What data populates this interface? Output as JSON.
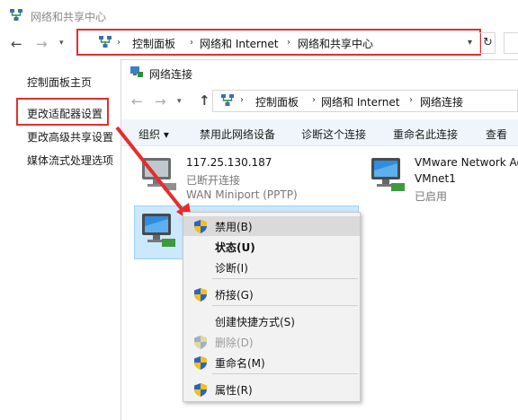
{
  "outer_window": {
    "title": "网络和共享中心",
    "breadcrumb": [
      "控制面板",
      "网络和 Internet",
      "网络和共享中心"
    ]
  },
  "sidebar": {
    "items": [
      {
        "label": "控制面板主页"
      },
      {
        "label": "更改适配器设置"
      },
      {
        "label": "更改高级共享设置"
      },
      {
        "label": "媒体流式处理选项"
      }
    ]
  },
  "inner_window": {
    "title": "网络连接",
    "breadcrumb": [
      "控制面板",
      "网络和 Internet",
      "网络连接"
    ],
    "toolbar": {
      "organize": "组织 ▾",
      "disable": "禁用此网络设备",
      "diagnose": "诊断这个连接",
      "rename": "重命名此连接",
      "view": "查看"
    },
    "connections": [
      {
        "name": "117.25.130.187",
        "status": "已断开连接",
        "device": "WAN Miniport (PPTP)"
      },
      {
        "name": "VMware Network Ad",
        "status": "VMnet1",
        "device": "已启用"
      }
    ]
  },
  "context_menu": {
    "items": [
      {
        "label": "禁用(B)",
        "shield": true,
        "state": "hover"
      },
      {
        "label": "状态(U)",
        "shield": false,
        "state": "bold"
      },
      {
        "label": "诊断(I)",
        "shield": false,
        "state": "normal"
      },
      {
        "label": "桥接(G)",
        "shield": true,
        "state": "normal"
      },
      {
        "label": "创建快捷方式(S)",
        "shield": false,
        "state": "normal"
      },
      {
        "label": "删除(D)",
        "shield": true,
        "state": "disabled"
      },
      {
        "label": "重命名(M)",
        "shield": true,
        "state": "normal"
      },
      {
        "label": "属性(R)",
        "shield": true,
        "state": "normal"
      }
    ]
  },
  "colors": {
    "highlight_box": "#e52d2d",
    "selection": "#cce8ff",
    "toolbar_bg": "#f0f5fb"
  }
}
